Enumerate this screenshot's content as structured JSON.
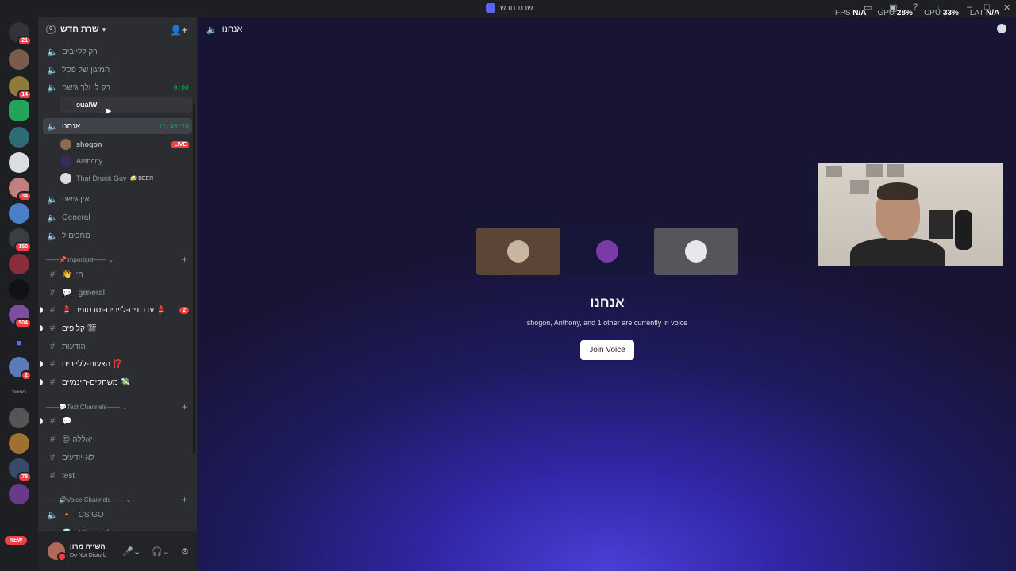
{
  "window": {
    "title": "שרת חדש"
  },
  "stats": {
    "fps_label": "FPS",
    "fps": "N/A",
    "gpu_label": "GPU",
    "gpu": "28%",
    "cpu_label": "CPU",
    "cpu": "33%",
    "lat_label": "LAT",
    "lat": "N/A"
  },
  "guilds": {
    "badges": [
      "21",
      "14",
      "34",
      "150",
      "504",
      "2",
      "78"
    ],
    "new_label": "NEW",
    "folder_label": "רעיונות"
  },
  "server": {
    "name": "שרת חדש",
    "boost_count": "0"
  },
  "channels": {
    "v1": "רק ללייבים",
    "v2": "המעון של פסל",
    "v3": "רק לי ולך גישה",
    "v3_timer": "0:00",
    "v3_user": "ɘualW",
    "v4": "אנחנו",
    "v4_timer": "11:46:10",
    "v4_user1": "shogon",
    "v4_user1_live": "LIVE",
    "v4_user2": "Anthony",
    "v4_user3": "That Drunk Guy",
    "v4_user3_tag": "🍻 BEER",
    "v5": "אין גישה",
    "v6": "General",
    "v7": "מחכים ל",
    "cat1": "——📌important——",
    "t1": "👋 הײ",
    "t2": "💬 | general",
    "t3": "💄 עדכונים-לייבים-וסרטונים 💄",
    "t3_unread": "2",
    "t4": "קליפים 🎬",
    "t5": "הודעות",
    "t6": "הצעות-ללייבים ⁉️",
    "t7": "משחקים-חינמיים 💸",
    "cat2": "——💬Text Channels——",
    "t8": "💬",
    "t9": "😍 יאללה",
    "t10": "לא-יודעים",
    "t11": "test",
    "cat3": "——🔊Voice Channels——",
    "v8": "🔸 | CS:GO",
    "v9": "💎 | Minecraft"
  },
  "user_panel": {
    "name": "השייח מרון",
    "status": "Do Not Disturb"
  },
  "main": {
    "header": "אנחנו",
    "channel_name": "אנחנו",
    "subtitle": "shogon, Anthony, and 1 other are currently in voice",
    "join_label": "Join Voice"
  }
}
